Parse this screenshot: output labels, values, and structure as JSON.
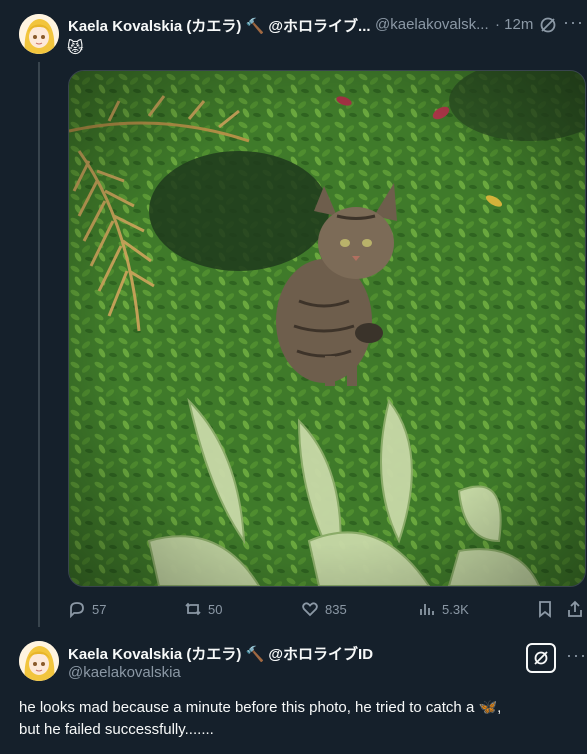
{
  "tweet1": {
    "display_name": "Kaela Kovalskia (カエラ) 🔨 @ホロライブ...",
    "handle": "@kaelakovalsk...",
    "time": "· 12m",
    "emoji": "😾",
    "actions": {
      "replies": "57",
      "retweets": "50",
      "likes": "835",
      "views": "5.3K"
    }
  },
  "tweet2": {
    "display_name": "Kaela Kovalskia (カエラ) 🔨 @ホロライブID",
    "handle": "@kaelakovalskia",
    "text_line1": "he looks mad because a minute before this photo, he tried to catch a 🦋,",
    "text_line2": "but he failed successfully.......",
    "more": "···"
  },
  "colors": {
    "background": "#15202b",
    "text": "#f7f9f9",
    "muted": "#8b98a5",
    "border": "#38444d"
  }
}
